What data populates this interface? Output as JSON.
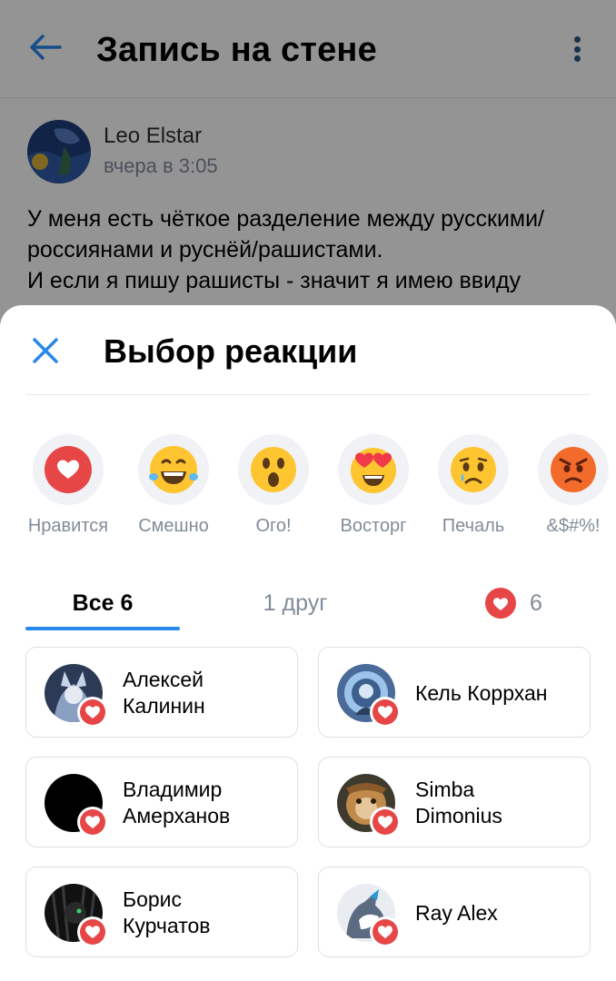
{
  "header": {
    "title": "Запись на стене"
  },
  "post": {
    "author": "Leo Elstar",
    "time": "вчера в 3:05",
    "lines": [
      "У меня есть чёткое разделение между русскими/",
      "россиянами и руснёй/рашистами.",
      "И если я пишу рашисты - значит я имею ввиду"
    ]
  },
  "sheet": {
    "title": "Выбор реакции",
    "reactions": [
      {
        "label": "Нравится",
        "icon": "heart-reaction-icon"
      },
      {
        "label": "Смешно",
        "icon": "laughing-face-icon"
      },
      {
        "label": "Ого!",
        "icon": "surprised-face-icon"
      },
      {
        "label": "Восторг",
        "icon": "heart-eyes-face-icon"
      },
      {
        "label": "Печаль",
        "icon": "crying-face-icon"
      },
      {
        "label": "&$#%!",
        "icon": "angry-face-icon"
      }
    ],
    "tabs": {
      "all": "Все 6",
      "friends": "1 друг",
      "likes_count": "6"
    },
    "users": [
      {
        "name_line1": "Алексей",
        "name_line2": "Калинин"
      },
      {
        "name_line1": "Кель Коррхан",
        "name_line2": ""
      },
      {
        "name_line1": "Владимир",
        "name_line2": "Амерханов"
      },
      {
        "name_line1": "Simba",
        "name_line2": "Dimonius"
      },
      {
        "name_line1": "Борис",
        "name_line2": "Курчатов"
      },
      {
        "name_line1": "Ray Alex",
        "name_line2": ""
      }
    ]
  },
  "colors": {
    "accent": "#2688eb",
    "like_red": "#e64646",
    "text_secondary": "#818c99"
  }
}
